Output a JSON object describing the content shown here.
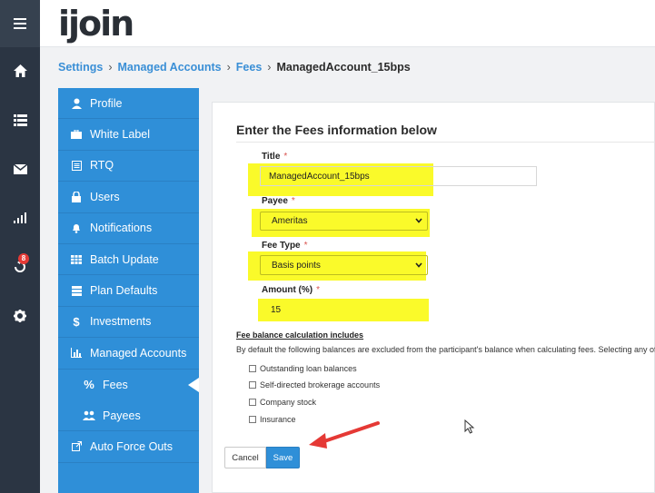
{
  "rail": {
    "badge_count": "8",
    "icons": [
      "menu-icon",
      "home-icon",
      "list-icon",
      "mail-icon",
      "bar-chart-icon",
      "alerts-icon",
      "gear-icon"
    ]
  },
  "header": {
    "logo": "ijoin"
  },
  "breadcrumb": {
    "items": [
      "Settings",
      "Managed Accounts",
      "Fees"
    ],
    "current": "ManagedAccount_15bps",
    "separator": "›"
  },
  "menu": {
    "items": [
      {
        "label": "Profile",
        "icon": "person-icon"
      },
      {
        "label": "White Label",
        "icon": "briefcase-icon"
      },
      {
        "label": "RTQ",
        "icon": "document-icon"
      },
      {
        "label": "Users",
        "icon": "lock-icon"
      },
      {
        "label": "Notifications",
        "icon": "bell-icon"
      },
      {
        "label": "Batch Update",
        "icon": "grid-icon"
      },
      {
        "label": "Plan Defaults",
        "icon": "sliders-icon"
      },
      {
        "label": "Investments",
        "icon": "dollar-icon"
      },
      {
        "label": "Managed Accounts",
        "icon": "chart-icon"
      },
      {
        "label": "Fees",
        "icon": "percent-icon"
      },
      {
        "label": "Payees",
        "icon": "people-icon"
      },
      {
        "label": "Auto Force Outs",
        "icon": "external-link-icon"
      }
    ],
    "active": "Fees"
  },
  "form": {
    "heading": "Enter the Fees information below",
    "title_label": "Title",
    "title_value": "ManagedAccount_15bps",
    "payee_label": "Payee",
    "payee_value": "Ameritas",
    "fee_type_label": "Fee Type",
    "fee_type_value": "Basis points",
    "amount_label": "Amount (%)",
    "amount_value": "15",
    "required_mark": "*",
    "fee_balance_title": "Fee balance calculation includes",
    "fee_balance_desc": "By default the following balances are excluded from the participant's balance when calculating fees. Selecting any of",
    "checkboxes": [
      "Outstanding loan balances",
      "Self-directed brokerage accounts",
      "Company stock",
      "Insurance"
    ],
    "cancel_label": "Cancel",
    "save_label": "Save"
  },
  "colors": {
    "rail": "#2b3543",
    "menu": "#2f8fd8",
    "highlight": "#fafa2a",
    "arrow": "#e53935",
    "link": "#3a8fd6"
  }
}
